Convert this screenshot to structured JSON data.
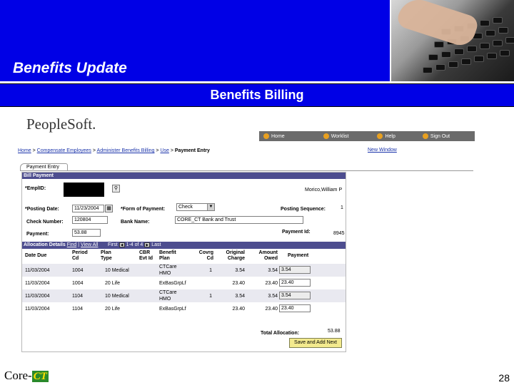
{
  "slide": {
    "title": "Benefits Update",
    "subtitle": "Benefits Billing",
    "footer_logo_prefix": "Core-",
    "footer_logo_ct": "CT",
    "page_number": "28",
    "colors": {
      "band": "#0000e6",
      "title_text": "#ffffff"
    }
  },
  "peoplesoft": {
    "logo": "PeopleSoft.",
    "nav": [
      {
        "label": "Home",
        "icon": "home-icon"
      },
      {
        "label": "Worklist",
        "icon": "worklist-icon"
      },
      {
        "label": "Help",
        "icon": "help-icon"
      },
      {
        "label": "Sign Out",
        "icon": "sign-out-icon"
      }
    ],
    "breadcrumb": {
      "home": "Home",
      "compensate": "Compensate Employees",
      "administer": "Administer Benefits Billing",
      "use": "Use",
      "current": "Payment Entry",
      "sep": " > "
    },
    "new_window": "New Window",
    "tab": "Payment Entry",
    "section_title": "Bill Payment",
    "form": {
      "emplid_label": "*EmplID:",
      "employee_name": "Morico,William P",
      "posting_date_label": "*Posting Date:",
      "posting_date_value": "11/23/2004",
      "form_of_payment_label": "*Form of Payment:",
      "form_of_payment_value": "Check",
      "posting_sequence_label": "Posting Sequence:",
      "posting_sequence_value": "1",
      "check_number_label": "Check Number:",
      "check_number_value": "120804",
      "bank_name_label": "Bank Name:",
      "bank_name_value": "CORE_CT Bank and Trust",
      "payment_label": "Payment:",
      "payment_value": "53.88",
      "payment_id_label": "Payment Id:",
      "payment_id_value": "8945"
    },
    "allocation": {
      "title": "Allocation Details",
      "find": "Find",
      "view_all": "View All",
      "first": "First",
      "counter": "1-4 of 4",
      "last": "Last",
      "headers": {
        "date_due": "Date Due",
        "period_cd": [
          "Period",
          "Cd"
        ],
        "plan_type": [
          "Plan",
          "Type"
        ],
        "cbr_evt": [
          "CBR",
          "Evt Id"
        ],
        "benefit_plan": [
          "Benefit",
          "Plan"
        ],
        "covrg_cd": [
          "Covrg",
          "Cd"
        ],
        "original_charge": [
          "Original",
          "Charge"
        ],
        "amount_owed": [
          "Amount",
          "Owed"
        ],
        "payment": "Payment"
      },
      "rows": [
        {
          "date_due": "11/03/2004",
          "period": "1004",
          "plan_type": "10 Medical",
          "benefit_plan": [
            "CTCare",
            "HMO"
          ],
          "covrg": "1",
          "original": "3.54",
          "owed": "3.54",
          "payment": "3.54"
        },
        {
          "date_due": "11/03/2004",
          "period": "1004",
          "plan_type": "20 Life",
          "benefit_plan": [
            "ExBasGrpLf",
            ""
          ],
          "covrg": "",
          "original": "23.40",
          "owed": "23.40",
          "payment": "23.40"
        },
        {
          "date_due": "11/03/2004",
          "period": "1104",
          "plan_type": "10 Medical",
          "benefit_plan": [
            "CTCare",
            "HMO"
          ],
          "covrg": "1",
          "original": "3.54",
          "owed": "3.54",
          "payment": "3.54"
        },
        {
          "date_due": "11/03/2004",
          "period": "1104",
          "plan_type": "20 Life",
          "benefit_plan": [
            "ExBasGrpLf",
            ""
          ],
          "covrg": "",
          "original": "23.40",
          "owed": "23.40",
          "payment": "23.40"
        }
      ],
      "total_label": "Total Allocation:",
      "total_value": "53.88",
      "save_button": "Save and Add Next"
    }
  }
}
